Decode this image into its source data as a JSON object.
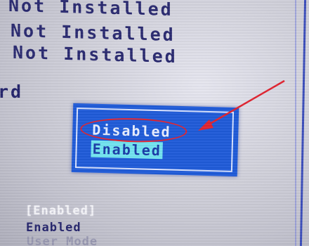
{
  "status_list": [
    {
      "value": "Not Installed"
    },
    {
      "value": "Not Installed"
    },
    {
      "value": "Not Installed"
    }
  ],
  "partial_label": "rd",
  "popup": {
    "options": [
      {
        "label": "Disabled",
        "highlighted": false
      },
      {
        "label": "Enabled",
        "highlighted": true
      }
    ]
  },
  "bottom": {
    "current_setting": "[Enabled]",
    "enabled_text": "Enabled",
    "user_mode": "User Mode"
  },
  "colors": {
    "screen_bg": "#d4d4de",
    "bios_text": "#2a2a70",
    "popup_bg": "#1f5bd8",
    "selection_bg": "#72e3ef",
    "annotation": "#e02330"
  },
  "annotation": {
    "circled_option": "Disabled"
  }
}
